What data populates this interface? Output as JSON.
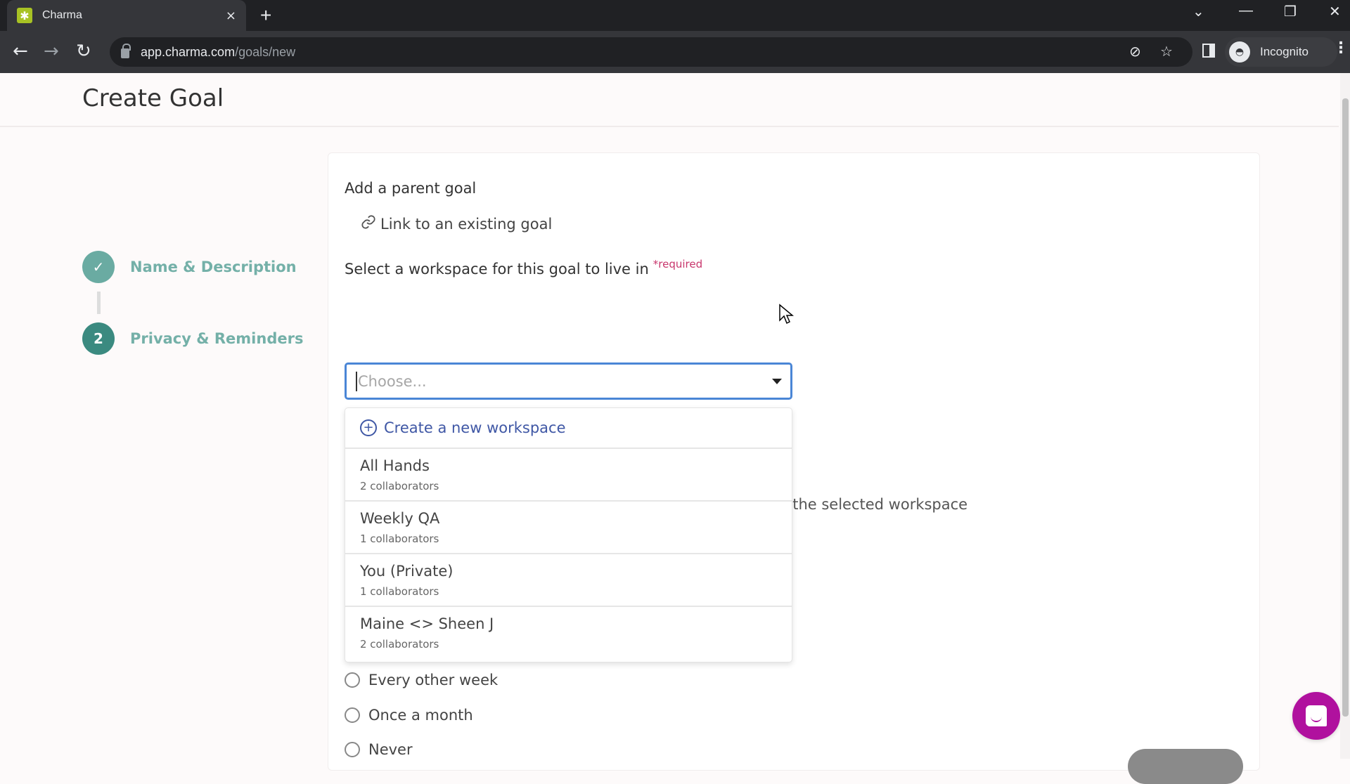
{
  "browser": {
    "tab_title": "Charma",
    "tab_close": "×",
    "new_tab": "+",
    "url_host": "app.charma.com",
    "url_path": "/goals/new",
    "profile_label": "Incognito",
    "icons": {
      "back": "←",
      "forward": "→",
      "reload": "↻",
      "eye_off": "⊘",
      "star": "☆",
      "tab_search": "⌄",
      "minimize": "—",
      "restore": "❐",
      "close": "✕",
      "menu": "⋮",
      "favicon": "✱",
      "incognito": "◓"
    }
  },
  "page": {
    "title": "Create Goal",
    "steps": [
      {
        "number": "✓",
        "label": "Name & Description",
        "state": "done"
      },
      {
        "number": "2",
        "label": "Privacy & Reminders",
        "state": "active"
      }
    ],
    "form": {
      "parent_goal_label": "Add a parent goal",
      "link_existing_label": "Link to an existing goal",
      "link_icon": "🔗",
      "workspace_label": "Select a workspace for this goal to live in",
      "required_label": "*required",
      "workspace_select": {
        "placeholder": "Choose...",
        "value": "",
        "open": true
      },
      "dropdown": {
        "create_label": "Create a new workspace",
        "create_icon": "+",
        "options": [
          {
            "name": "All Hands",
            "subtitle": "2 collaborators"
          },
          {
            "name": "Weekly QA",
            "subtitle": "1 collaborators"
          },
          {
            "name": "You (Private)",
            "subtitle": "1 collaborators"
          },
          {
            "name": "Maine <> Sheen J",
            "subtitle": "2 collaborators"
          }
        ]
      },
      "partial_hint": "added to the selected workspace",
      "reminder_options": [
        {
          "label": "Every other week",
          "checked": false
        },
        {
          "label": "Once a month",
          "checked": false
        },
        {
          "label": "Never",
          "checked": false
        }
      ]
    },
    "colors": {
      "step_done": "#6aaba2",
      "step_active": "#3b8a80",
      "link_blue": "#3f57a5",
      "focus_border": "#4a86d6",
      "required": "#c8366c",
      "chat_bubble": "#b0119e"
    }
  }
}
